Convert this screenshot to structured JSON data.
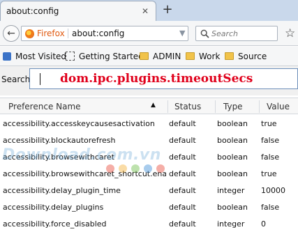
{
  "tab": {
    "title": "about:config",
    "close": "✕",
    "new_tab": "+"
  },
  "navbar": {
    "back": "←",
    "identity": "Firefox",
    "url": "about:config",
    "star": "☆",
    "search_placeholder": "Search",
    "bookmark_star": "☆"
  },
  "bookmarks": [
    {
      "label": "Most Visited",
      "icon": "most-visited-icon"
    },
    {
      "label": "Getting Started",
      "icon": "page-icon"
    },
    {
      "label": "ADMIN",
      "icon": "folder-icon"
    },
    {
      "label": "Work",
      "icon": "folder-icon"
    },
    {
      "label": "Source",
      "icon": "folder-icon"
    }
  ],
  "filter": {
    "label": "Search:",
    "value": "dom.ipc.plugins.timeoutSecs"
  },
  "table": {
    "headers": {
      "name": "Preference Name",
      "status": "Status",
      "type": "Type",
      "value": "Value"
    },
    "sort_indicator": "▲",
    "rows": [
      {
        "name": "accessibility.accesskeycausesactivation",
        "status": "default",
        "type": "boolean",
        "value": "true"
      },
      {
        "name": "accessibility.blockautorefresh",
        "status": "default",
        "type": "boolean",
        "value": "false"
      },
      {
        "name": "accessibility.browsewithcaret",
        "status": "default",
        "type": "boolean",
        "value": "false"
      },
      {
        "name": "accessibility.browsewithcaret_shortcut.ena...",
        "status": "default",
        "type": "boolean",
        "value": "true"
      },
      {
        "name": "accessibility.delay_plugin_time",
        "status": "default",
        "type": "integer",
        "value": "10000"
      },
      {
        "name": "accessibility.delay_plugins",
        "status": "default",
        "type": "boolean",
        "value": "false"
      },
      {
        "name": "accessibility.force_disabled",
        "status": "default",
        "type": "integer",
        "value": "0"
      }
    ]
  },
  "watermark": {
    "text": "Download.com.vn"
  },
  "colors": {
    "accent_red": "#e0001b",
    "firefox_orange": "#e15a10",
    "tabstrip": "#c9d8eb"
  }
}
